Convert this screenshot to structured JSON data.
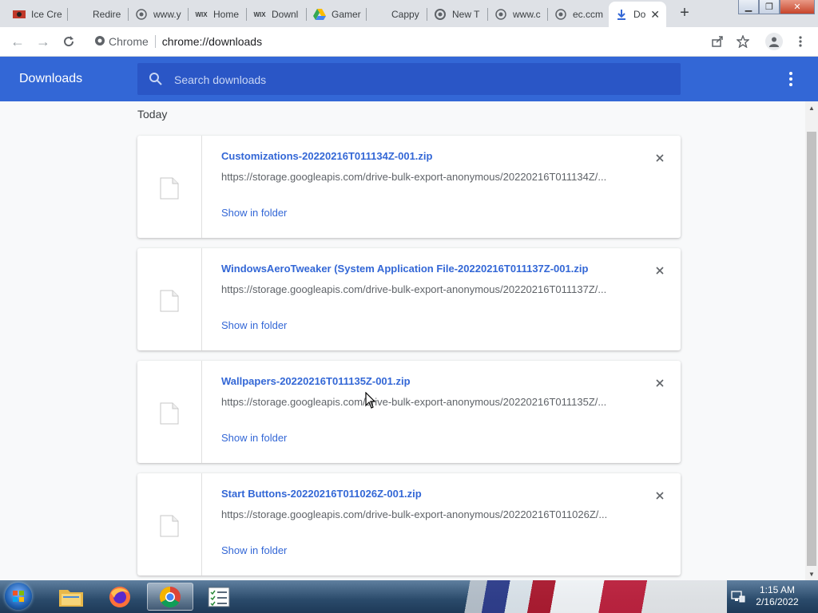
{
  "tabs": [
    {
      "title": "Ice Cre",
      "icon": "ice-cream-favicon"
    },
    {
      "title": "Redire",
      "icon": "blank-favicon"
    },
    {
      "title": "www.y",
      "icon": "globe-icon"
    },
    {
      "title": "Home",
      "icon": "wix-favicon"
    },
    {
      "title": "Downl",
      "icon": "wix-favicon"
    },
    {
      "title": "Gamer",
      "icon": "google-drive-favicon"
    },
    {
      "title": "Cappy",
      "icon": "blank-favicon"
    },
    {
      "title": "New T",
      "icon": "chrome-icon"
    },
    {
      "title": "www.c",
      "icon": "globe-icon"
    },
    {
      "title": "ec.ccm",
      "icon": "globe-icon"
    },
    {
      "title": "Do",
      "icon": "download-icon"
    }
  ],
  "wix_text": "WIX",
  "address": {
    "site_label": "Chrome",
    "url": "chrome://downloads"
  },
  "downloads": {
    "title": "Downloads",
    "search_placeholder": "Search downloads",
    "section": "Today",
    "items": [
      {
        "filename": "Customizations-20220216T011134Z-001.zip",
        "url": "https://storage.googleapis.com/drive-bulk-export-anonymous/20220216T011134Z/...",
        "action": "Show in folder"
      },
      {
        "filename": "WindowsAeroTweaker (System Application File-20220216T011137Z-001.zip",
        "url": "https://storage.googleapis.com/drive-bulk-export-anonymous/20220216T011137Z/...",
        "action": "Show in folder"
      },
      {
        "filename": "Wallpapers-20220216T011135Z-001.zip",
        "url": "https://storage.googleapis.com/drive-bulk-export-anonymous/20220216T011135Z/...",
        "action": "Show in folder"
      },
      {
        "filename": "Start Buttons-20220216T011026Z-001.zip",
        "url": "https://storage.googleapis.com/drive-bulk-export-anonymous/20220216T011026Z/...",
        "action": "Show in folder"
      }
    ]
  },
  "clock": {
    "time": "1:15 AM",
    "date": "2/16/2022"
  },
  "colors": {
    "accent": "#3367d6",
    "search_bg": "#2a56c6",
    "link": "#3367d6"
  }
}
